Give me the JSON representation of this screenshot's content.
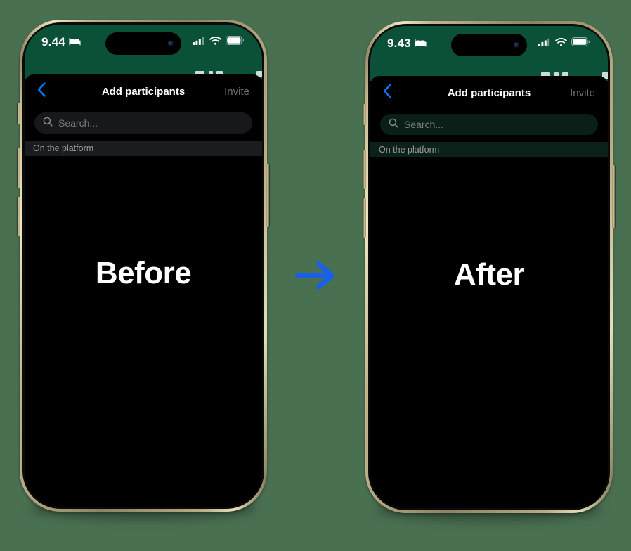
{
  "page": {
    "background_color": "#4a7052",
    "arrow_color": "#1a5fe8",
    "arrow_icon": "arrow-right-icon"
  },
  "phones": [
    {
      "id": "before",
      "stage_label": "Before",
      "theme": "neutral",
      "accent_color": "#0b5138",
      "field_color": "#16181b",
      "status_bar": {
        "time": "9.44",
        "focus_icon": "bed-icon",
        "cellular_icon": "cellular-bars-icon",
        "wifi_icon": "wifi-icon",
        "battery_icon": "battery-full-icon"
      },
      "navbar": {
        "back_icon": "chevron-left-icon",
        "title": "Add participants",
        "action_label": "Invite",
        "action_enabled": false
      },
      "search": {
        "icon": "search-icon",
        "placeholder": "Search...",
        "value": ""
      },
      "section_header": "On the platform"
    },
    {
      "id": "after",
      "stage_label": "After",
      "theme": "green-tinted",
      "accent_color": "#0b5138",
      "field_color": "#0a1f18",
      "status_bar": {
        "time": "9.43",
        "focus_icon": "bed-icon",
        "cellular_icon": "cellular-bars-icon",
        "wifi_icon": "wifi-icon",
        "battery_icon": "battery-full-icon"
      },
      "navbar": {
        "back_icon": "chevron-left-icon",
        "title": "Add participants",
        "action_label": "Invite",
        "action_enabled": false
      },
      "search": {
        "icon": "search-icon",
        "placeholder": "Search...",
        "value": ""
      },
      "section_header": "On the platform"
    }
  ]
}
